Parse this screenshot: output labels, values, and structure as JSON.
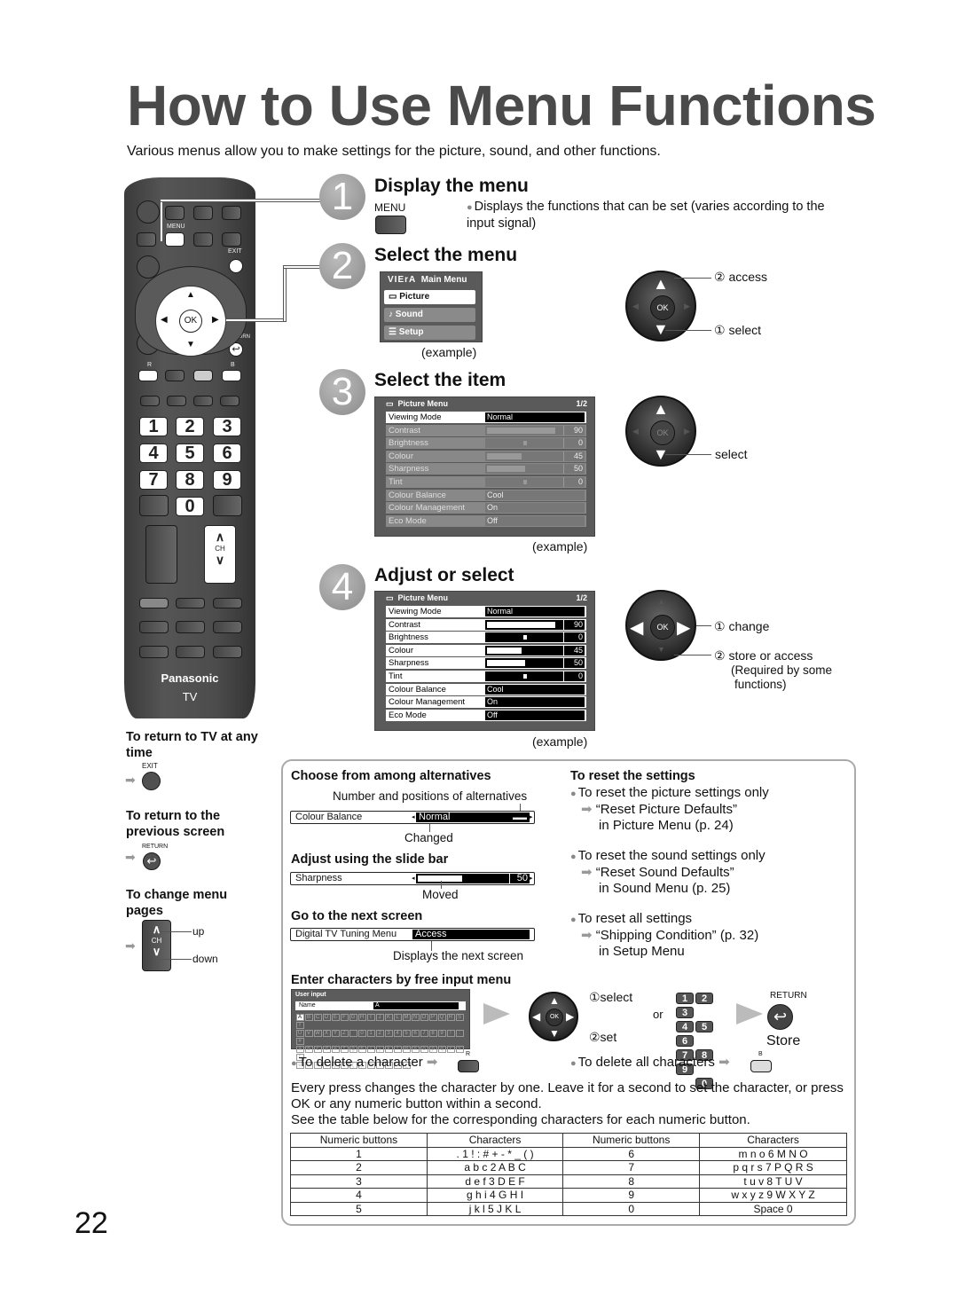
{
  "page": {
    "title": "How to Use Menu Functions",
    "intro": "Various menus allow you to make settings for the picture, sound, and other functions.",
    "page_number": "22"
  },
  "remote": {
    "labels": {
      "menu": "MENU",
      "exit": "EXIT",
      "ok": "OK",
      "return": "RETURN",
      "r": "R",
      "b": "B",
      "ch": "CH",
      "brand": "Panasonic",
      "tv": "TV"
    },
    "numbers": [
      "1",
      "2",
      "3",
      "4",
      "5",
      "6",
      "7",
      "8",
      "9",
      "0"
    ]
  },
  "steps": [
    {
      "num": "1",
      "title": "Display the menu",
      "button_label": "MENU",
      "desc": "Displays the functions that can be set (varies according to the input signal)"
    },
    {
      "num": "2",
      "title": "Select the menu",
      "caption": "(example)",
      "main_menu": {
        "brand": "VIErA",
        "title": "Main Menu",
        "items": [
          {
            "icon": "tv-icon",
            "label": "Picture"
          },
          {
            "icon": "music-note-icon",
            "label": "Sound"
          },
          {
            "icon": "list-icon",
            "label": "Setup"
          }
        ]
      },
      "dial": {
        "ok": "OK",
        "label_access": "② access",
        "label_select": "① select"
      }
    },
    {
      "num": "3",
      "title": "Select the item",
      "caption": "(example)",
      "dial": {
        "ok": "OK",
        "label_select": "select"
      }
    },
    {
      "num": "4",
      "title": "Adjust or select",
      "caption": "(example)",
      "dial": {
        "ok": "OK",
        "label_change": "① change",
        "label_store": "② store or access",
        "label_note1": "(Required by some",
        "label_note2": "functions)"
      }
    }
  ],
  "picture_menu": {
    "title": "Picture Menu",
    "page": "1/2",
    "rows": [
      {
        "label": "Viewing Mode",
        "value": "Normal",
        "type": "option"
      },
      {
        "label": "Contrast",
        "value": "90",
        "type": "slider",
        "level": 0.9
      },
      {
        "label": "Brightness",
        "value": "0",
        "type": "center",
        "level": 0.5
      },
      {
        "label": "Colour",
        "value": "45",
        "type": "slider",
        "level": 0.45
      },
      {
        "label": "Sharpness",
        "value": "50",
        "type": "slider",
        "level": 0.5
      },
      {
        "label": "Tint",
        "value": "0",
        "type": "center",
        "level": 0.5
      },
      {
        "label": "Colour Balance",
        "value": "Cool",
        "type": "option"
      },
      {
        "label": "Colour Management",
        "value": "On",
        "type": "option"
      },
      {
        "label": "Eco Mode",
        "value": "Off",
        "type": "option"
      }
    ]
  },
  "side_notes": [
    {
      "title": "To return to TV at any time",
      "button": "EXIT"
    },
    {
      "title": "To return to the previous screen",
      "button": "RETURN"
    },
    {
      "title": "To change menu pages",
      "button": "CH",
      "up": "up",
      "down": "down"
    }
  ],
  "box": {
    "choose": {
      "title": "Choose from among alternatives",
      "note_top": "Number and positions of alternatives",
      "bar_label": "Colour Balance",
      "bar_value": "Normal",
      "note_bottom": "Changed"
    },
    "slide": {
      "title": "Adjust using the slide bar",
      "bar_label": "Sharpness",
      "bar_value": "50",
      "level": 0.5,
      "note": "Moved"
    },
    "next": {
      "title": "Go to the next screen",
      "bar_label": "Digital TV Tuning Menu",
      "bar_value": "Access",
      "note": "Displays the next screen"
    },
    "reset": {
      "title": "To reset the settings",
      "items": [
        {
          "bullet": "To reset the picture settings only",
          "line1": "“Reset Picture Defaults”",
          "line2": "in Picture Menu (p. 24)"
        },
        {
          "bullet": "To reset the sound settings only",
          "line1": "“Reset Sound Defaults”",
          "line2": "in Sound Menu (p. 25)"
        },
        {
          "bullet": "To reset all settings",
          "line1": "“Shipping Condition” (p. 32)",
          "line2": "in Setup Menu"
        }
      ]
    },
    "free_input": {
      "title": "Enter characters by free input menu",
      "ui_title": "User input",
      "name_label": "Name",
      "name_value": "A",
      "keyboard_rows": [
        [
          "A",
          "B",
          "C",
          "D",
          "E",
          "F",
          "G",
          "H",
          "I",
          "J",
          "K",
          "L",
          "M",
          "N",
          "O",
          "P",
          "Q",
          "R",
          "S",
          "T"
        ],
        [
          "U",
          "V",
          "W",
          "X",
          "Y",
          "Z",
          " ",
          "0",
          "1",
          "2",
          "3",
          "4",
          "5",
          "6",
          "7",
          "8",
          "9",
          "!",
          ":",
          "#"
        ],
        [
          "a",
          "b",
          "c",
          "d",
          "e",
          "f",
          "g",
          "h",
          "i",
          "j",
          "k",
          "l",
          "m",
          "n",
          "o",
          "p",
          "q",
          "r",
          "s",
          "t"
        ],
        [
          "u",
          "v",
          "w",
          "x",
          "y",
          "z",
          "(",
          ")",
          "+",
          "-",
          ".",
          "*",
          "_"
        ]
      ],
      "dial_select": "①select",
      "dial_set": "②set",
      "or": "or",
      "return_label": "RETURN",
      "store": "Store",
      "delete_char": "To delete a character",
      "delete_char_btn": "R",
      "delete_all": "To delete all characters",
      "delete_all_btn": "B"
    },
    "para1": "Every press changes the character by one. Leave it for a second to set the character, or press OK or any numeric button within a second.",
    "para2": "See the table below for the corresponding characters for each numeric button.",
    "table": {
      "headers": [
        "Numeric buttons",
        "Characters",
        "Numeric buttons",
        "Characters"
      ],
      "rows": [
        [
          "1",
          ". 1 ! : # + - * _ ( )",
          "6",
          "m n o 6 M N O"
        ],
        [
          "2",
          "a b c 2 A B C",
          "7",
          "p q r s 7 P Q R S"
        ],
        [
          "3",
          "d e f 3 D E F",
          "8",
          "t u v 8 T U V"
        ],
        [
          "4",
          "g h i 4 G H I",
          "9",
          "w x y z 9 W X Y Z"
        ],
        [
          "5",
          "j k l 5 J K L",
          "0",
          "Space 0"
        ]
      ]
    }
  }
}
